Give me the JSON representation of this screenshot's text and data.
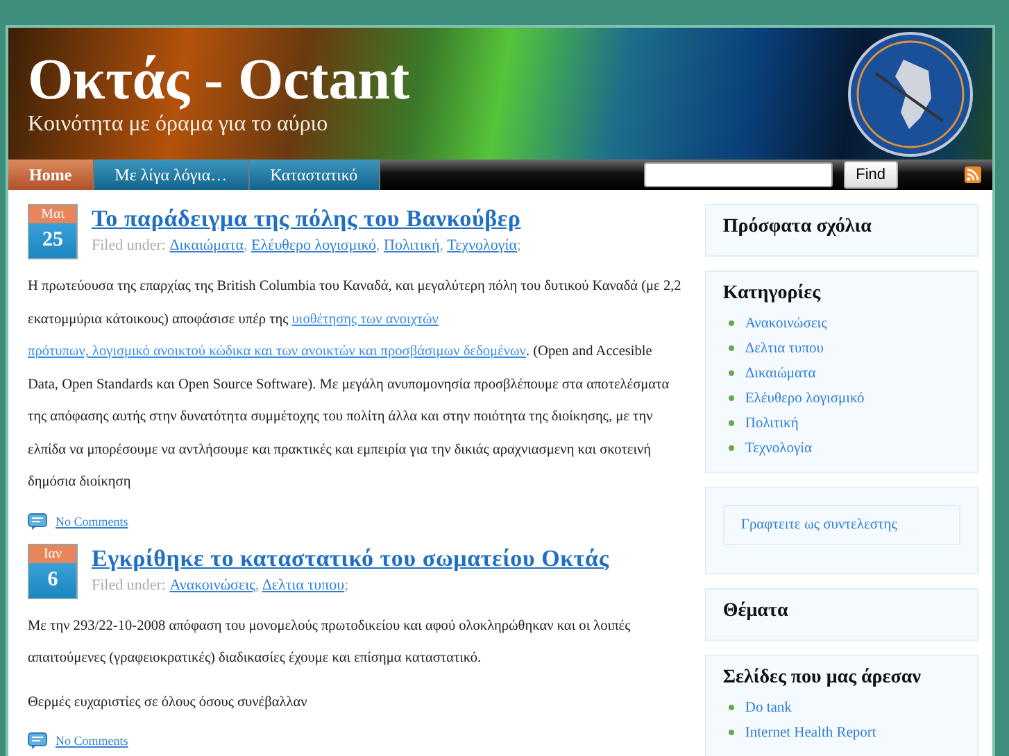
{
  "header": {
    "title": "Οκτάς - Octant",
    "tagline": "Κοινότητα με όραμα για το αύριο"
  },
  "nav": {
    "items": [
      {
        "label": "Home",
        "selected": true
      },
      {
        "label": "Με λίγα λόγια…",
        "selected": false
      },
      {
        "label": "Καταστατικό",
        "selected": false
      }
    ],
    "search": {
      "button": "Find"
    }
  },
  "posts": [
    {
      "month": "Μαι",
      "day": "25",
      "title": "Το παράδειγμα της πόλης του Βανκούβερ",
      "filed_label": "Filed under:",
      "categories": [
        "Δικαιώματα",
        "Ελέυθερο λογισμικό",
        "Πολιτική",
        "Τεχνολογία"
      ],
      "separator": ",",
      "end_mark": ";",
      "paragraphs": [
        [
          {
            "kind": "text",
            "text": "Η πρωτεύουσα της επαρχίας της British Columbia του Καναδά, και μεγαλύτερη πόλη του δυτικού Καναδά (με 2,2 εκατομμύρια κάτοικους) αποφάσισε υπέρ της "
          },
          {
            "kind": "link",
            "text": "υιοθέτησης των ανοιχτών"
          },
          {
            "kind": "link",
            "text": "πρότυπων, λογισμικό ανοικτού κώδικα και των ανοικτών και προσβάσιμων δεδομένων"
          },
          {
            "kind": "text",
            "text": ". (Open and Accesible Data, Open Standards και Open Source Software). Με μεγάλη ανυπομονησία προσβλέπουμε στα αποτελέσματα της απόφασης αυτής στην δυνατότητα συμμέτοχης του πολίτη άλλα και στην ποιότητα της διοίκησης, με την ελπίδα να μπορέσουμε να αντλήσουμε και πρακτικές και εμπειρία για την δικιάς αραχνιασμενη και σκοτεινή δημόσια διοίκηση"
          }
        ]
      ],
      "comments": "No Comments"
    },
    {
      "month": "Ιαν",
      "day": "6",
      "title": "Εγκρίθηκε το καταστατικό του σωματείου Οκτάς",
      "filed_label": "Filed under:",
      "categories": [
        "Ανακοινώσεις",
        "Δελτια τυπου"
      ],
      "separator": ",",
      "end_mark": ";",
      "paragraphs": [
        [
          {
            "kind": "text",
            "text": "Με την 293/22-10-2008 απόφαση του μονομελούς πρωτοδικείου και αφού ολοκληρώθηκαν και οι λοιπές απαιτούμενες (γραφειοκρατικές) διαδικασίες έχουμε και επίσημα καταστατικό."
          }
        ],
        [
          {
            "kind": "text",
            "text": "Θερμές ευχαριστίες σε όλους όσους συνέβαλλαν"
          }
        ]
      ],
      "comments": "No Comments"
    }
  ],
  "sidebar": [
    {
      "kind": "heading",
      "title": "Πρόσφατα σχόλια"
    },
    {
      "kind": "list",
      "title": "Κατηγορίες",
      "items": [
        "Ανακοινώσεις",
        "Δελτια τυπου",
        "Δικαιώματα",
        "Ελέυθερο λογισμικό",
        "Πολιτική",
        "Τεχνολογία"
      ]
    },
    {
      "kind": "boxed_link",
      "text": "Γραφτειτε ως συντελεστης"
    },
    {
      "kind": "heading",
      "title": "Θέματα"
    },
    {
      "kind": "list",
      "title": "Σελίδες που μας άρεσαν",
      "items": [
        "Do tank",
        "Internet Health Report"
      ]
    }
  ]
}
